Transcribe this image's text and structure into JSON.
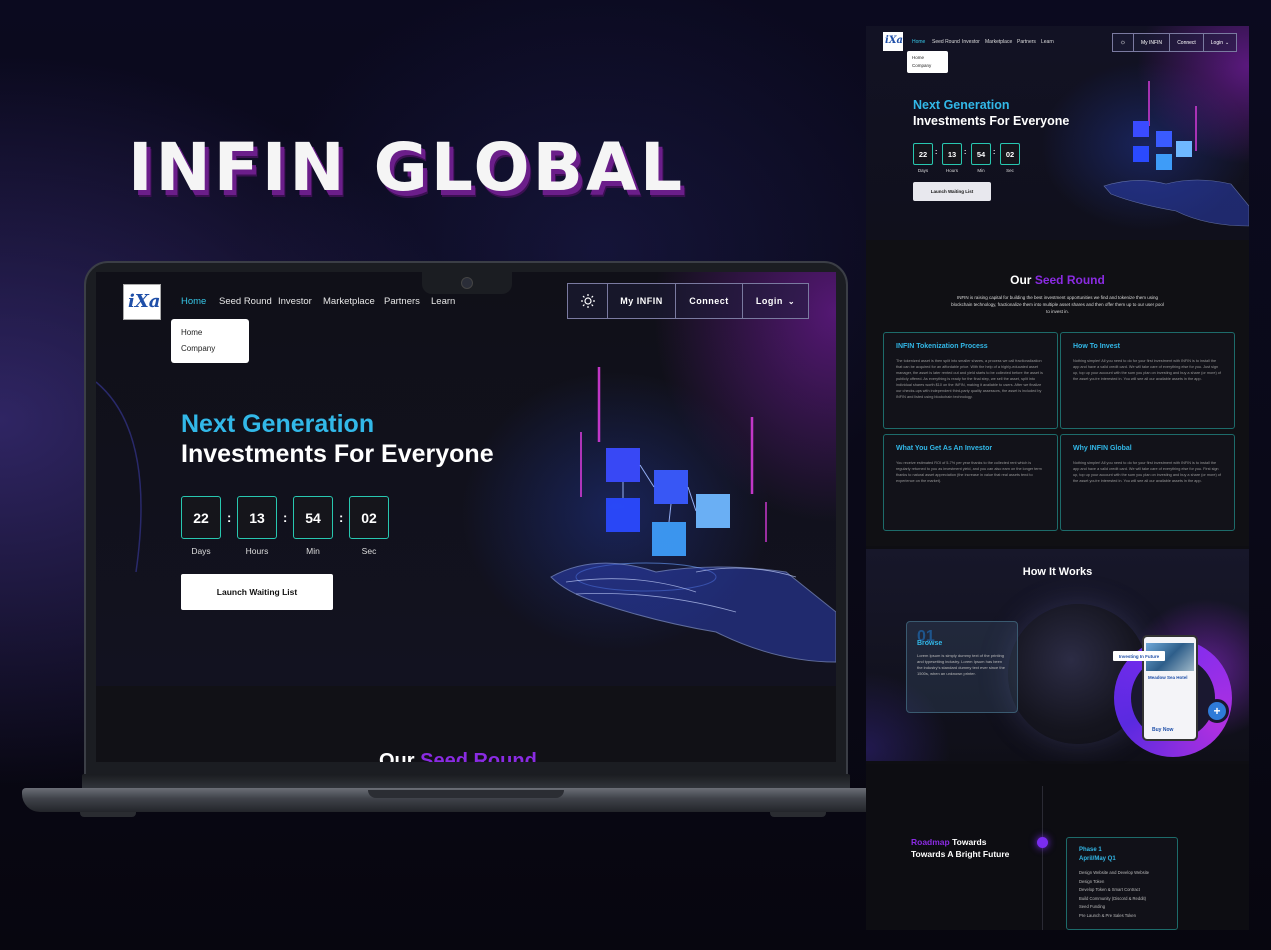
{
  "brand_title": "INFIN GLOBAL",
  "colors": {
    "accent_cyan": "#32b8e8",
    "accent_purple": "#8a2be2",
    "countdown_border": "#28c7b0"
  },
  "site": {
    "logo_text": "iXa",
    "nav": [
      "Home",
      "Seed Round",
      "Investor",
      "Marketplace",
      "Partners",
      "Learn"
    ],
    "active_nav": "Home",
    "theme_icon": "sun-icon",
    "my_infin": "My INFIN",
    "connect": "Connect",
    "login": "Login",
    "dropdown": [
      "Home",
      "Company"
    ]
  },
  "hero": {
    "line1": "Next Generation",
    "line2": "Investments For Everyone",
    "countdown": [
      {
        "value": "22",
        "label": "Days"
      },
      {
        "value": "13",
        "label": "Hours"
      },
      {
        "value": "54",
        "label": "Min"
      },
      {
        "value": "02",
        "label": "Sec"
      }
    ],
    "button": "Launch Waiting List"
  },
  "seed": {
    "title_white": "Our",
    "title_accent": "Seed Round",
    "desc": "INFIN is raising capital for building the best investment opportunities we find and tokenize them using blockchain technology, fractionalize them into multiple asset shares and then offer them up to our user pool to invest in.",
    "cards": [
      {
        "title": "INFIN Tokenization Process",
        "body": "The tokenized asset is then split into smaller shares, a process we call fractionalization that can be acquired for an affordable price. With the help of a highly-educated asset manager, the asset is later rented out and yield starts to be collected before the asset is publicly offered. As everything is ready for the final step, we sell the asset, split into individual shares worth $10 on the INFIN, making it available to users. After we finalize our checks-ups with independent third-party quality assessors, the asset is included by INFIN and listed using blockchain technology."
      },
      {
        "title": "How To Invest",
        "body": "Nothing simpler! All you need to do for your first investment with INFIN is to install the app and have a valid credit card. We will take care of everything else for you. Just sign up, top up your account with the sum you plan on investing and buy a share (or more) of the asset you're interested in. You will see all our available assets in the app."
      },
      {
        "title": "What You Get As An Investor",
        "body": "You receive estimated ROI of 5-7% per year thanks to the collected rent which is regularly returned to you as investment yield, and you can also earn on the longer term thanks to natural asset appreciation (the increase in value that real assets tend to experience on the market)."
      },
      {
        "title": "Why INFIN Global",
        "body": "Nothing simpler! All you need to do for your first investment with INFIN is to install the app and have a valid credit card. We will take care of everything else for you. First sign up, top up your account with the sum you plan on investing and buy a share (or more) of the asset you're interested in. You will see all our available assets in the app."
      }
    ]
  },
  "how": {
    "title": "How It Works",
    "step_number": "01",
    "step_title": "Browse",
    "step_body": "Lorem Ipsum is simply dummy text of the printing and typesetting industry. Lorem Ipsum has been the industry's standard dummy text ever since the 1500s, when an unknown printer.",
    "chip": "Investing In Future",
    "phone_title": "Meadow Sea Hotel",
    "phone_buy": "Buy Now",
    "plus": "+"
  },
  "roadmap": {
    "title_accent": "Roadmap",
    "title_rest": "Towards",
    "title_line2": "Towards A Bright Future",
    "phase": "Phase 1",
    "period": "April/May  Q1",
    "items": [
      "Design Website and Develop Website",
      "Design Token",
      "Develop Token & Smart Contract",
      "Build Community (Discord & Reddit)",
      "Seed Funding",
      "Pre Launch & Pre Sales Token"
    ]
  }
}
